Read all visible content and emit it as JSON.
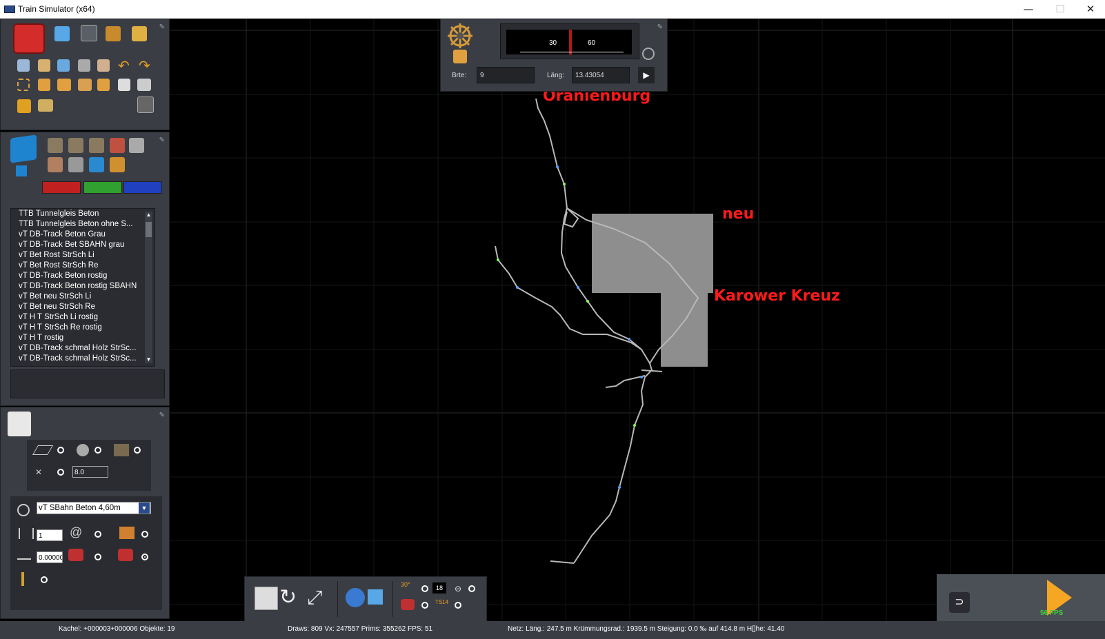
{
  "window": {
    "title": "Train Simulator (x64)",
    "minimize": "—",
    "maximize": "☐",
    "close": "✕"
  },
  "compass": {
    "width_label": "Brte:",
    "width_value": "9",
    "length_label": "Läng:",
    "length_value": "13.43054",
    "scale_30": "30",
    "scale_60": "60"
  },
  "track_list": {
    "items": [
      "TTB Tunnelgleis Beton",
      "TTB Tunnelgleis Beton ohne S...",
      "vT DB-Track Beton Grau",
      "vT DB-Track Bet SBAHN grau",
      "vT Bet Rost StrSch Li",
      "vT Bet Rost StrSch Re",
      "vT DB-Track Beton rostig",
      "vT DB-Track Beton rostig SBAHN",
      "vT Bet neu StrSch Li",
      "vT Bet neu StrSch Re",
      "vT H T StrSch Li rostig",
      "vT H T StrSch Re rostig",
      "vT H T rostig",
      "vT DB-Track schmal Holz StrSc...",
      "vT DB-Track schmal Holz StrSc..."
    ]
  },
  "track_panel": {
    "spacing_value": "8.0",
    "rule_select": "vT SBahn Beton 4,60m",
    "count_value": "1",
    "gradient_value": "0.00000"
  },
  "map_labels": {
    "north": "Oranienburg",
    "new": "neu",
    "junction": "Karower Kreuz"
  },
  "toolbar": {
    "counter": "18",
    "ts_label": "TS14",
    "grid_label": "30°"
  },
  "fps": "56 FPS",
  "status": {
    "tile": "Kachel: +000003+000006  Objekte: 19",
    "draws": "Draws: 809 Vx: 247557 Prims: 355262 FPS: 51",
    "net": "Netz:  Läng.:  247.5 m Krümmungsrad.: 1939.5 m Steigung:  0.0 ‰ auf 414.8 m H[]he:  41.40"
  },
  "colors": {
    "panel": "#3a3d44",
    "accent_red": "#ff1a1a",
    "track": "#b8b8b8",
    "area": "#8e8e8e",
    "play": "#f5a623"
  }
}
